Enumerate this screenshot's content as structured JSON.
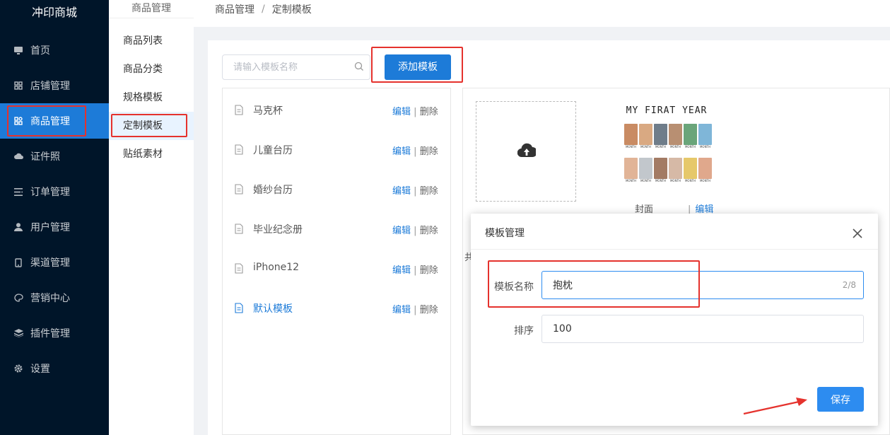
{
  "sidebar": {
    "brand": "冲印商城",
    "items": [
      {
        "label": "首页",
        "icon": "monitor-icon"
      },
      {
        "label": "店铺管理",
        "icon": "grid-icon"
      },
      {
        "label": "商品管理",
        "icon": "apps-icon"
      },
      {
        "label": "证件照",
        "icon": "cloud-icon"
      },
      {
        "label": "订单管理",
        "icon": "list-icon"
      },
      {
        "label": "用户管理",
        "icon": "user-icon"
      },
      {
        "label": "渠道管理",
        "icon": "phone-icon"
      },
      {
        "label": "营销中心",
        "icon": "palette-icon"
      },
      {
        "label": "插件管理",
        "icon": "layers-icon"
      },
      {
        "label": "设置",
        "icon": "gear-icon"
      }
    ]
  },
  "subnav": {
    "title": "商品管理",
    "items": [
      {
        "label": "商品列表"
      },
      {
        "label": "商品分类"
      },
      {
        "label": "规格模板"
      },
      {
        "label": "定制模板"
      },
      {
        "label": "贴纸素材"
      }
    ]
  },
  "breadcrumb": {
    "parent": "商品管理",
    "separator": "/",
    "current": "定制模板"
  },
  "toolbar": {
    "search_placeholder": "请输入模板名称",
    "add_label": "添加模板"
  },
  "templates": {
    "edit_label": "编辑",
    "delete_label": "删除",
    "divider": "|",
    "items": [
      {
        "name": "马克杯"
      },
      {
        "name": "儿童台历"
      },
      {
        "name": "婚纱台历"
      },
      {
        "name": "毕业纪念册"
      },
      {
        "name": "iPhone12"
      },
      {
        "name": "默认模板"
      }
    ]
  },
  "preview": {
    "cover_title": "MY FIRAT YEAR",
    "photo_caption": "MONTH",
    "cover_label": "封面",
    "edit_label": "编辑",
    "hint_fragment": "共"
  },
  "modal": {
    "title": "模板管理",
    "name_label": "模板名称",
    "name_value": "抱枕",
    "name_count": "2/8",
    "sort_label": "排序",
    "sort_value": "100",
    "save_label": "保存"
  },
  "colors": {
    "sidebar_bg": "#001529",
    "accent": "#1d7bd8",
    "highlight": "#e5322d"
  }
}
